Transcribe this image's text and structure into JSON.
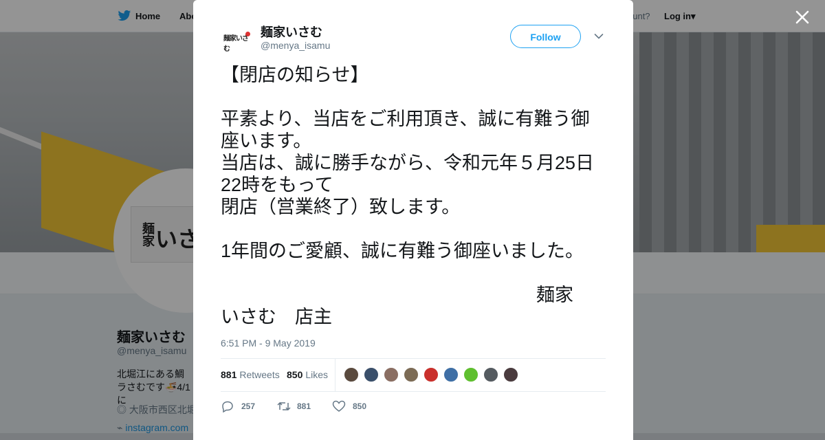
{
  "nav": {
    "home_label": "Home",
    "about_label": "Abo",
    "account_prompt": "ccount?",
    "login_label": "Log in"
  },
  "profile": {
    "name": "麺家いさむ",
    "handle": "@menya_isamu",
    "bio": "北堀江にある鯛ラさむです🍜4/1に",
    "location": "大阪市西区北堀",
    "link": "instagram.com",
    "avatar_text_vertical": "麺家",
    "avatar_text": "いさ"
  },
  "tweet": {
    "author_name": "麺家いさむ",
    "author_handle": "@menya_isamu",
    "avatar_logo_text": "麺家いさむ",
    "follow_label": "Follow",
    "text": "【閉店の知らせ】\n\n平素より、当店をご利用頂き、誠に有難う御座います。\n当店は、誠に勝手ながら、令和元年５月25日22時をもって\n閉店（営業終了）致します。\n\n1年間のご愛顧、誠に有難う御座いました。\n\n　　　　　　　　　　　　　　　　　麺家　いさむ　店主",
    "timestamp": "6:51 PM - 9 May 2019",
    "retweets_count": "881",
    "retweets_label": "Retweets",
    "likes_count": "850",
    "likes_label": "Likes",
    "reply_count": "257",
    "retweet_action_count": "881",
    "like_action_count": "850",
    "liker_colors": [
      "#5a4a3e",
      "#3a4f6a",
      "#8a6e62",
      "#7c6b55",
      "#c9302c",
      "#3f6fa5",
      "#5fbf2f",
      "#555b60",
      "#4a3b3e"
    ]
  },
  "icons": {
    "close": "close-icon",
    "caret": "chevron-down-icon",
    "twitter": "twitter-bird-icon",
    "reply": "reply-icon",
    "retweet": "retweet-icon",
    "like": "heart-icon",
    "location": "location-pin-icon",
    "link": "link-icon"
  },
  "colors": {
    "accent": "#1da1f2",
    "text": "#14171a",
    "muted": "#657786"
  }
}
